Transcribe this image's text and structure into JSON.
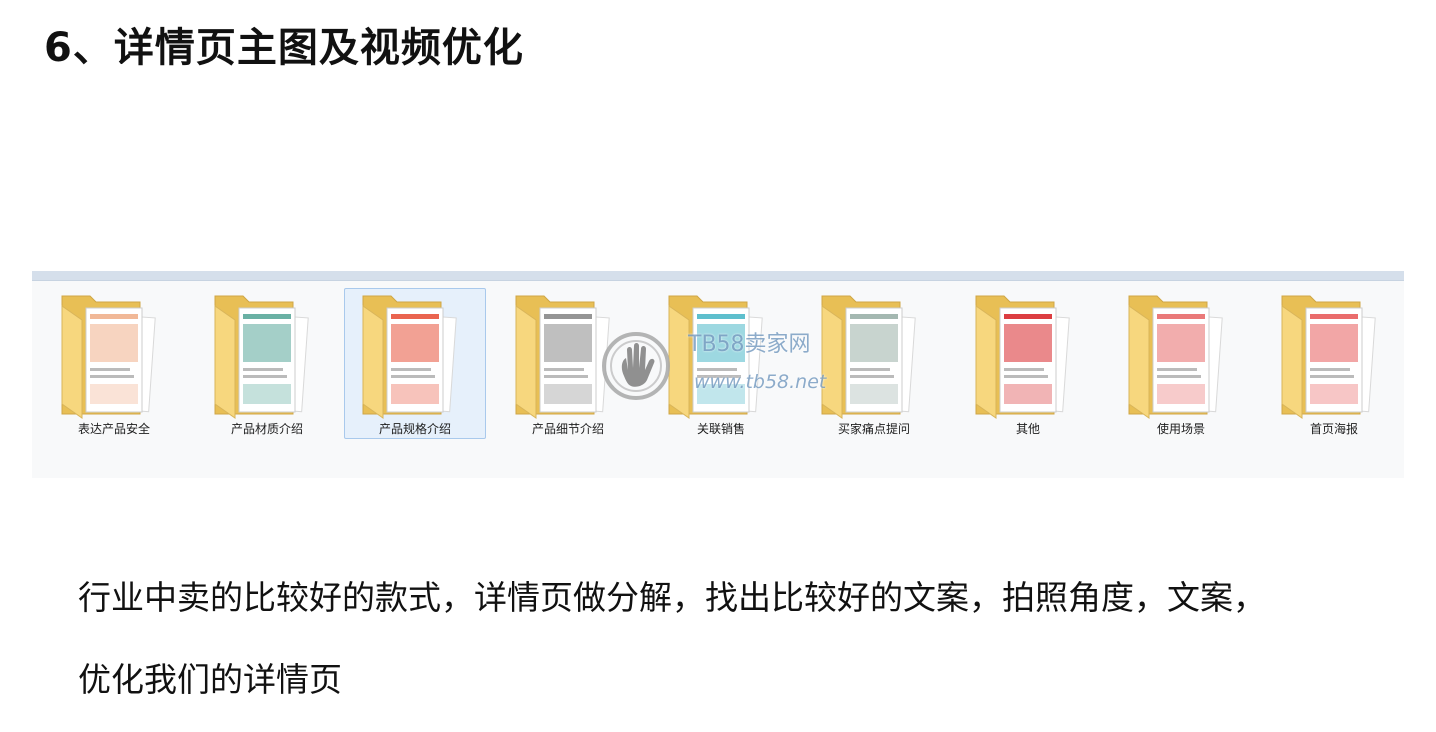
{
  "slide": {
    "title": "6、详情页主图及视频优化",
    "body_lines": [
      "行业中卖的比较好的款式，详情页做分解，找出比较好的文案，拍照角度，文案，",
      "优化我们的详情页"
    ]
  },
  "explorer": {
    "selected_index": 2,
    "folders": [
      {
        "label": "表达产品安全",
        "icon": "folder-icon",
        "accent": "#f0b08c"
      },
      {
        "label": "产品材质介绍",
        "icon": "folder-icon",
        "accent": "#5aa89a"
      },
      {
        "label": "产品规格介绍",
        "icon": "folder-icon",
        "accent": "#e8533c"
      },
      {
        "label": "产品细节介绍",
        "icon": "folder-icon",
        "accent": "#8a8a8a"
      },
      {
        "label": "关联销售",
        "icon": "folder-icon",
        "accent": "#4cb8c8"
      },
      {
        "label": "买家痛点提问",
        "icon": "folder-icon",
        "accent": "#9ab0a8"
      },
      {
        "label": "其他",
        "icon": "folder-icon",
        "accent": "#d8282c"
      },
      {
        "label": "使用场景",
        "icon": "folder-icon",
        "accent": "#e86a6a"
      },
      {
        "label": "首页海报",
        "icon": "folder-icon",
        "accent": "#e85c5c"
      }
    ]
  },
  "watermark": {
    "name": "TB58卖家网",
    "url": "www.tb58.net",
    "icon": "hand-logo-icon"
  },
  "colors": {
    "folder_front": "#f7d77e",
    "folder_back": "#e8bf55",
    "toolbar": "#d5dfeb",
    "selection": "#e6f0fb"
  }
}
